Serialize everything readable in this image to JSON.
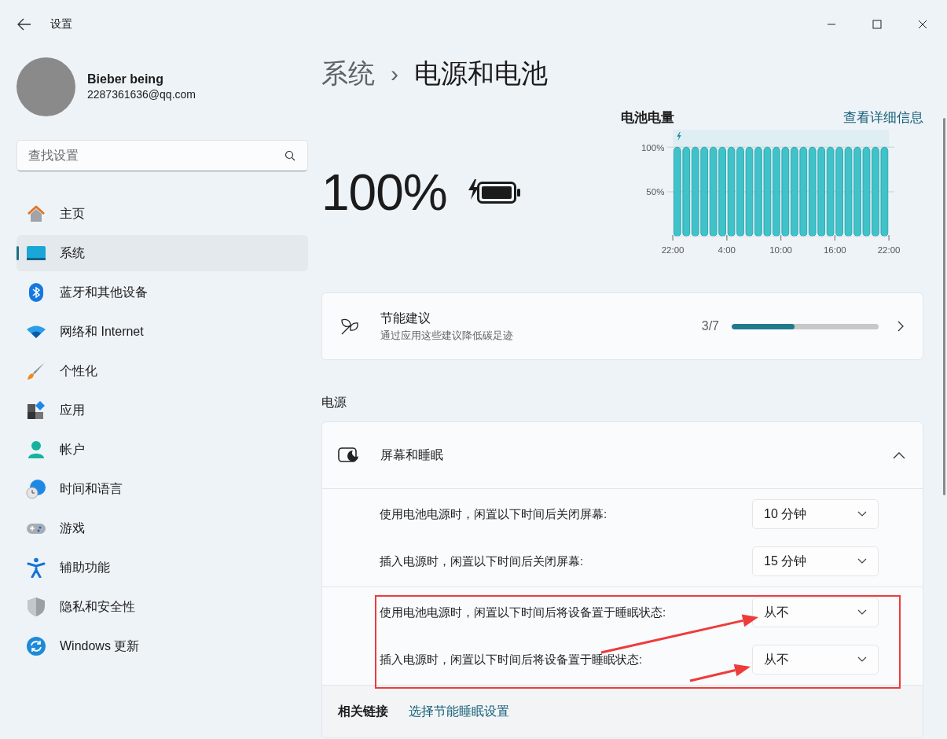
{
  "window": {
    "title": "设置"
  },
  "profile": {
    "name": "Bieber being",
    "email": "2287361636@qq.com"
  },
  "search": {
    "placeholder": "查找设置"
  },
  "sidebar": {
    "items": [
      {
        "label": "主页",
        "selected": false
      },
      {
        "label": "系统",
        "selected": true
      },
      {
        "label": "蓝牙和其他设备",
        "selected": false
      },
      {
        "label": "网络和 Internet",
        "selected": false
      },
      {
        "label": "个性化",
        "selected": false
      },
      {
        "label": "应用",
        "selected": false
      },
      {
        "label": "帐户",
        "selected": false
      },
      {
        "label": "时间和语言",
        "selected": false
      },
      {
        "label": "游戏",
        "selected": false
      },
      {
        "label": "辅助功能",
        "selected": false
      },
      {
        "label": "隐私和安全性",
        "selected": false
      },
      {
        "label": "Windows 更新",
        "selected": false
      }
    ]
  },
  "breadcrumb": {
    "parent": "系统",
    "separator": "›",
    "current": "电源和电池"
  },
  "battery": {
    "percent": "100%",
    "charging": true
  },
  "battery_chart": {
    "title": "电池电量",
    "link": "查看详细信息",
    "charging": true,
    "chart_data": {
      "type": "bar",
      "categories": [
        "22:00",
        null,
        null,
        null,
        null,
        null,
        "4:00",
        null,
        null,
        null,
        null,
        null,
        "10:00",
        null,
        null,
        null,
        null,
        null,
        "16:00",
        null,
        null,
        null,
        null,
        null,
        "22:00"
      ],
      "series": [
        {
          "color": "#3fc3c8",
          "values": [
            100,
            100,
            100,
            100,
            100,
            100,
            100,
            100,
            100,
            100,
            100,
            100,
            100,
            100,
            100,
            100,
            100,
            100,
            100,
            100,
            100,
            100,
            100,
            100,
            null
          ]
        }
      ],
      "ylim": [
        0,
        100
      ],
      "yticks": [
        {
          "value": 50,
          "label": "50%"
        },
        {
          "value": 100,
          "label": "100%"
        }
      ]
    }
  },
  "energy_card": {
    "title": "节能建议",
    "subtitle": "通过应用这些建议降低碳足迹",
    "count": "3/7",
    "level": 0.4286
  },
  "power_section": {
    "heading": "电源",
    "expander": {
      "title": "屏幕和睡眠",
      "expanded": true,
      "groups": [
        [
          {
            "label": "使用电池电源时，闲置以下时间后关闭屏幕:",
            "value": "10 分钟"
          },
          {
            "label": "插入电源时，闲置以下时间后关闭屏幕:",
            "value": "15 分钟"
          }
        ],
        [
          {
            "label": "使用电池电源时，闲置以下时间后将设备置于睡眠状态:",
            "value": "从不"
          },
          {
            "label": "插入电源时，闲置以下时间后将设备置于睡眠状态:",
            "value": "从不"
          }
        ]
      ]
    },
    "related": {
      "label": "相关链接",
      "link": "选择节能睡眠设置"
    }
  },
  "annotations": [
    {
      "kind": "frame"
    },
    {
      "kind": "arrow"
    },
    {
      "kind": "arrow"
    }
  ]
}
